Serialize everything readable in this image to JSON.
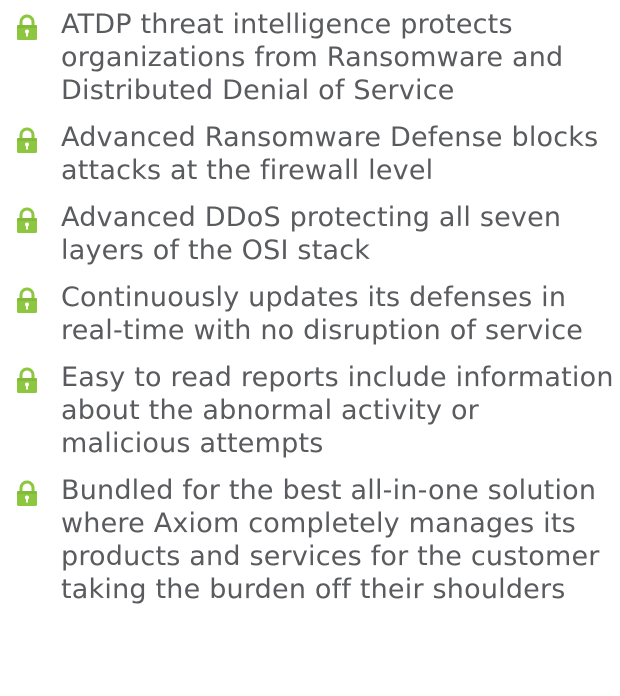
{
  "theme": {
    "text_color": "#5a5b5e",
    "icon_color": "#8dc63f",
    "icon_shadow_color": "#6fa52e"
  },
  "features": {
    "icon": "padlock-icon",
    "items": [
      {
        "text": "ATDP threat intelligence protects organizations from Ransomware and Distributed Denial of Service"
      },
      {
        "text": "Advanced Ransomware Defense blocks attacks at the firewall level"
      },
      {
        "text": "Advanced DDoS protecting all seven layers of the OSI stack"
      },
      {
        "text": "Continuously updates its defenses in real-time with no disruption of service"
      },
      {
        "text": "Easy to read reports include information about the abnormal activity or malicious attempts"
      },
      {
        "text": "Bundled for the best all-in-one solution where Axiom completely manages its products and services for the customer taking the burden off their shoulders"
      }
    ]
  }
}
